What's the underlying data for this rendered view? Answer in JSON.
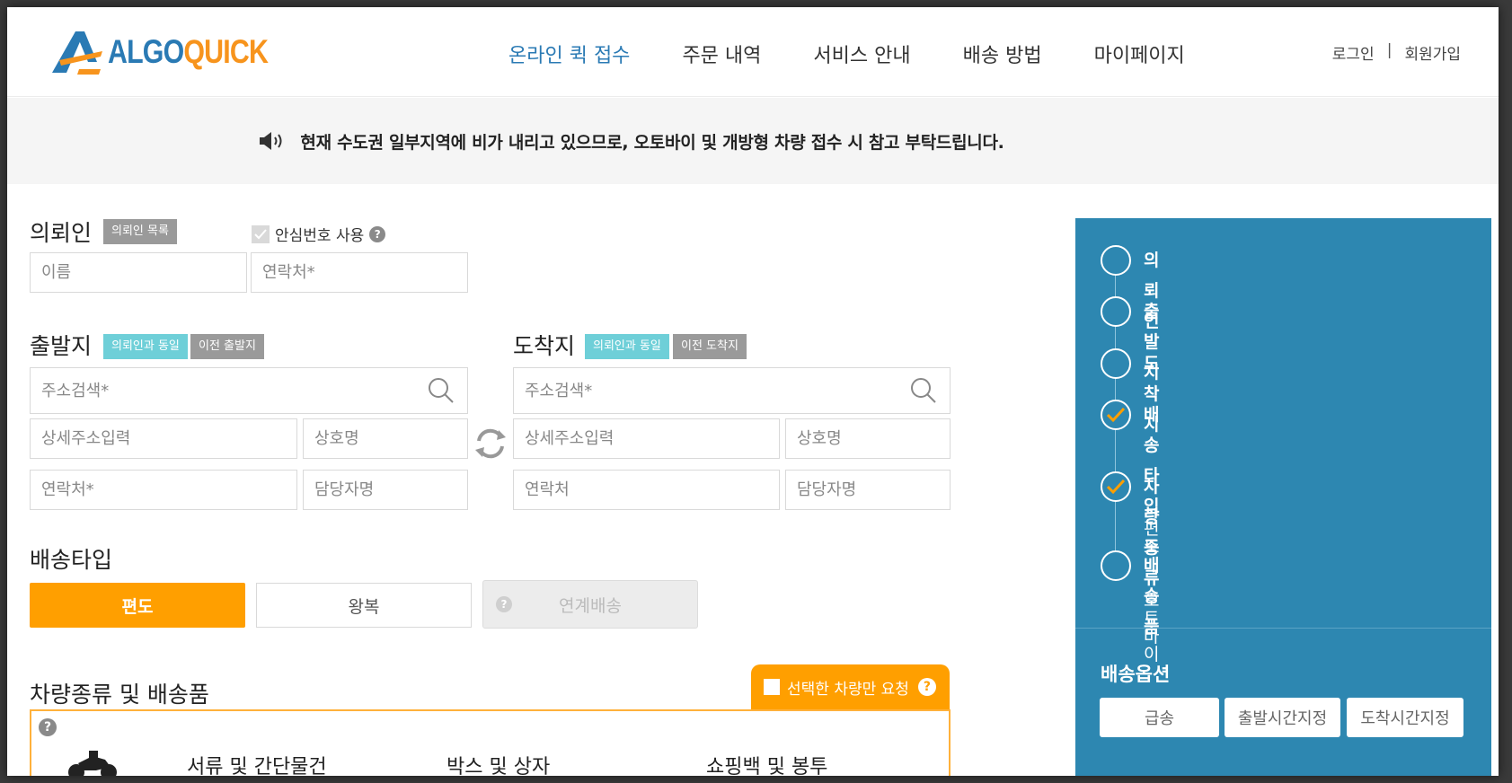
{
  "header": {
    "logo": {
      "part1": "ALGO",
      "part2": "QUICK"
    },
    "nav": [
      "온라인 퀵 접수",
      "주문 내역",
      "서비스 안내",
      "배송 방법",
      "마이페이지"
    ],
    "login": "로그인",
    "signup": "회원가입"
  },
  "notice": {
    "text": "현재 수도권 일부지역에 비가 내리고 있으므로, 오토바이 및 개방형 차량 접수 시 참고 부탁드립니다."
  },
  "client": {
    "title": "의뢰인",
    "list_button": "의뢰인 목록",
    "safe_number_label": "안심번호 사용",
    "safe_number_checked": true,
    "name_placeholder": "이름",
    "phone_placeholder": "연락처*"
  },
  "origin": {
    "title": "출발지",
    "same_as_client": "의뢰인과 동일",
    "previous": "이전 출발지",
    "address_placeholder": "주소검색*",
    "detail_placeholder": "상세주소입력",
    "company_placeholder": "상호명",
    "phone_placeholder": "연락처*",
    "manager_placeholder": "담당자명"
  },
  "destination": {
    "title": "도착지",
    "same_as_client": "의뢰인과 동일",
    "previous": "이전 도착지",
    "address_placeholder": "주소검색*",
    "detail_placeholder": "상세주소입력",
    "company_placeholder": "상호명",
    "phone_placeholder": "연락처",
    "manager_placeholder": "담당자명"
  },
  "delivery_type": {
    "title": "배송타입",
    "options": [
      "편도",
      "왕복",
      "연계배송"
    ],
    "selected": "편도",
    "help": "?"
  },
  "vehicle": {
    "title": "차량종류 및 배송품",
    "selected_only_label": "선택한 차량만 요청",
    "help": "?",
    "categories": [
      "서류 및 간단물건",
      "박스 및 상자",
      "쇼핑백 및 봉투"
    ]
  },
  "sidebar": {
    "steps": [
      {
        "label": "의뢰인",
        "value": "",
        "done": false
      },
      {
        "label": "출발지",
        "value": "",
        "done": false
      },
      {
        "label": "도착지",
        "value": "",
        "done": false
      },
      {
        "label": "배송타입",
        "value": "편도",
        "done": true
      },
      {
        "label": "차량종류",
        "value": "오토바이",
        "done": true
      },
      {
        "label": "배송품",
        "value": "",
        "done": false
      }
    ],
    "options_title": "배송옵션",
    "options": [
      "급송",
      "출발시간지정",
      "도착시간지정"
    ]
  },
  "colors": {
    "brand_blue": "#2a7ab4",
    "brand_orange": "#f7941d",
    "accent_orange": "#ff9f00",
    "sidebar_blue": "#2d87b1",
    "tag_teal": "#6ecfd8",
    "tag_gray": "#9a9a9a"
  }
}
